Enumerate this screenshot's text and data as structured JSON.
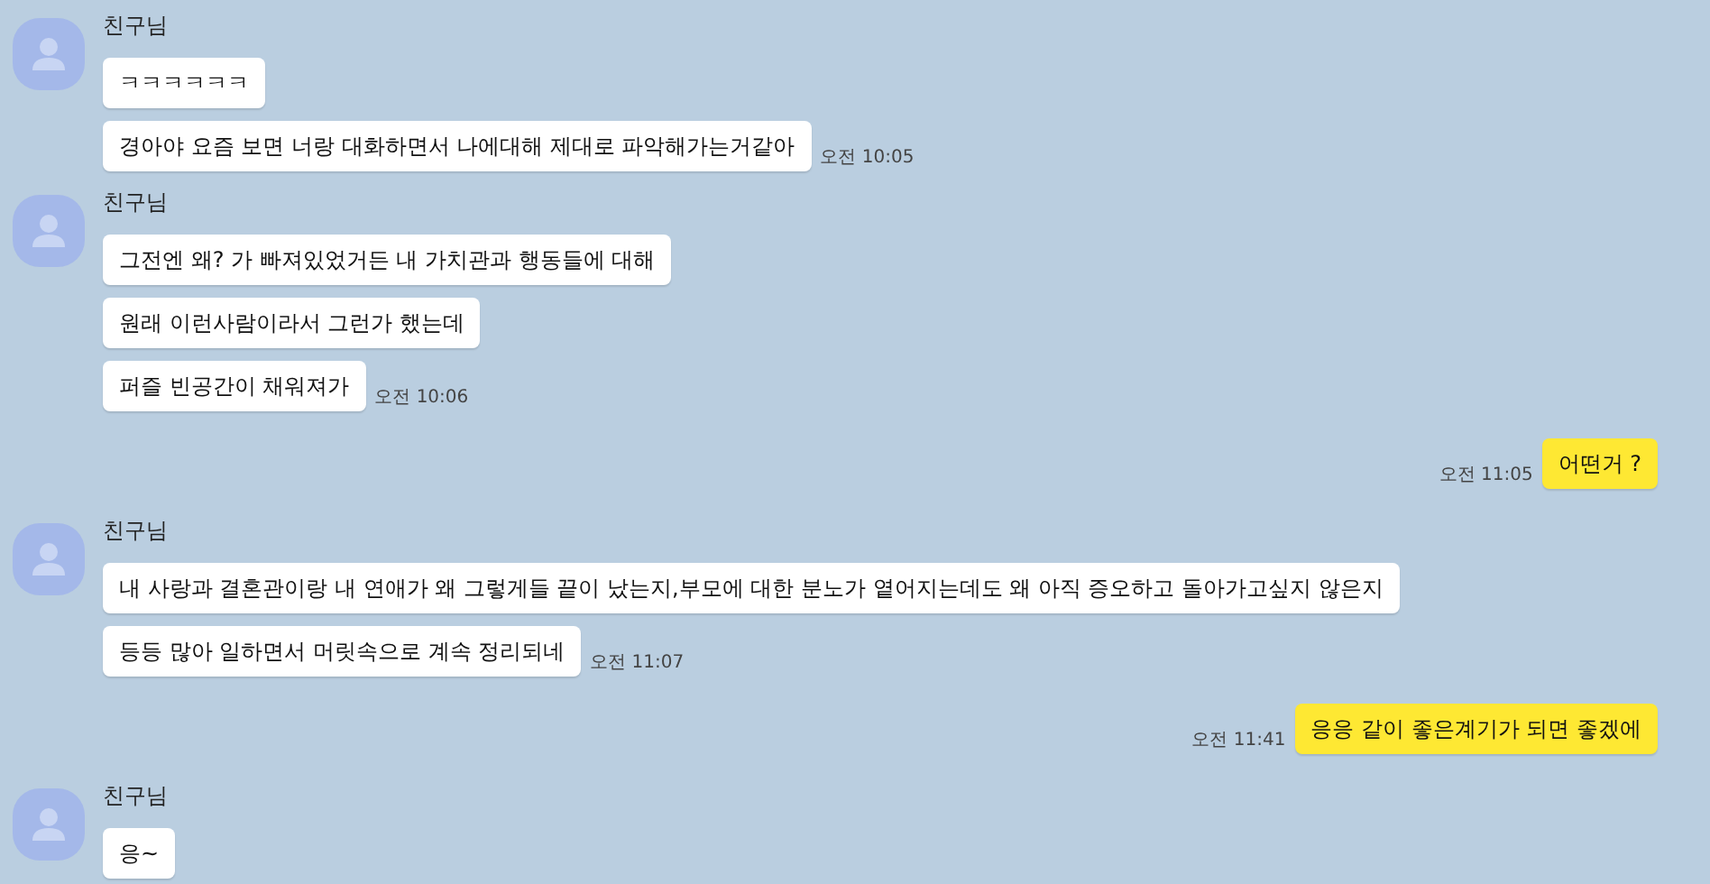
{
  "messages": [
    {
      "kind": "received",
      "sender": "친구님",
      "bubbles": [
        "ㅋㅋㅋㅋㅋㅋ",
        "경아야 요즘 보면 너랑 대화하면서 나에대해 제대로 파악해가는거같아"
      ],
      "time": "오전 10:05"
    },
    {
      "kind": "received",
      "sender": "친구님",
      "bubbles": [
        "그전엔 왜? 가 빠져있었거든 내 가치관과 행동들에 대해",
        "원래 이런사람이라서 그런가 했는데",
        "퍼즐 빈공간이 채워져가"
      ],
      "time": "오전 10:06"
    },
    {
      "kind": "sent",
      "bubbles": [
        "어떤거 ?"
      ],
      "time": "오전 11:05"
    },
    {
      "kind": "received",
      "sender": "친구님",
      "bubbles": [
        "내 사랑과 결혼관이랑 내 연애가 왜 그렇게들 끝이 났는지,부모에 대한 분노가 옅어지는데도 왜 아직 증오하고 돌아가고싶지 않은지",
        "등등 많아 일하면서 머릿속으로 계속 정리되네"
      ],
      "time": "오전 11:07"
    },
    {
      "kind": "sent",
      "bubbles": [
        "응응 같이 좋은계기가 되면 좋겠에"
      ],
      "time": "오전 11:41"
    },
    {
      "kind": "received",
      "sender": "친구님",
      "bubbles": [
        "응~"
      ]
    }
  ]
}
